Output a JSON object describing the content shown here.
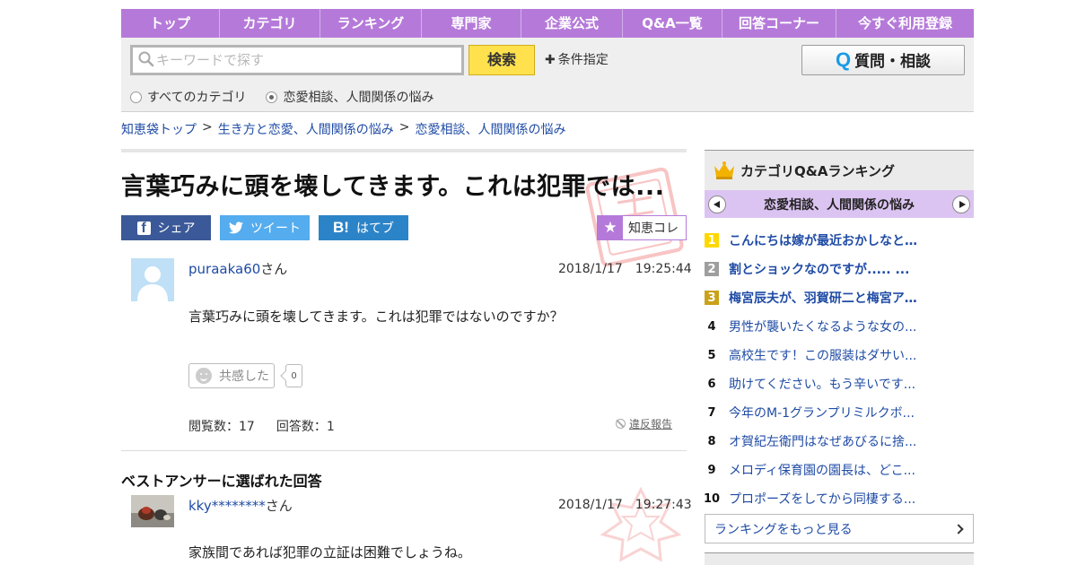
{
  "nav": [
    "トップ",
    "カテゴリ",
    "ランキング",
    "専門家",
    "企業公式",
    "Q&A一覧",
    "回答コーナー",
    "今すぐ利用登録"
  ],
  "search": {
    "placeholder": "キーワードで探す",
    "button": "検索",
    "condition": "条件指定",
    "ask_button": "質問・相談",
    "ask_icon": "Q",
    "radios": [
      "すべてのカテゴリ",
      "恋愛相談、人間関係の悩み"
    ],
    "radio_selected_index": 1
  },
  "breadcrumb": [
    {
      "label": "知恵袋トップ"
    },
    {
      "label": "生き方と恋愛、人間関係の悩み"
    },
    {
      "label": "恋愛相談、人間関係の悩み"
    }
  ],
  "breadcrumb_sep": ">",
  "question": {
    "title": "言葉巧みに頭を壊してきます。これは犯罪では...",
    "share": {
      "facebook": "シェア",
      "twitter": "ツイート",
      "hatena": "はてブ",
      "collect": "知恵コレ"
    },
    "user": "puraaka60",
    "user_suffix": "さん",
    "date": "2018/1/17　19:25:44",
    "body": "言葉巧みに頭を壊してきます。これは犯罪ではないのですか？",
    "empathy_label": "共感した",
    "empathy_count": "0",
    "views": "閲覧数：17",
    "answers": "回答数：1",
    "report": "違反報告"
  },
  "best_answer": {
    "heading": "ベストアンサーに選ばれた回答",
    "user": "kky********",
    "user_suffix": "さん",
    "date": "2018/1/17　19:27:43",
    "body": "家族間であれば犯罪の立証は困難でしょうね。"
  },
  "ranking": {
    "title": "カテゴリQ&Aランキング",
    "category": "恋愛相談、人間関係の悩み",
    "items": [
      {
        "rank": "1",
        "text": "こんにちは嫁が最近おかしなと..."
      },
      {
        "rank": "2",
        "text": "割とショックなのですが..... ..."
      },
      {
        "rank": "3",
        "text": "梅宮辰夫が、羽賀研二と梅宮ア..."
      },
      {
        "rank": "4",
        "text": "男性が襲いたくなるような女の..."
      },
      {
        "rank": "5",
        "text": "高校生です！この服装はダサい..."
      },
      {
        "rank": "6",
        "text": "助けてください。もう辛いです..."
      },
      {
        "rank": "7",
        "text": "今年のM-1グランプリミルクボ..."
      },
      {
        "rank": "8",
        "text": "オ賀紀左衛門はなぜあびるに捨..."
      },
      {
        "rank": "9",
        "text": "メロディ保育園の園長は、どこ..."
      },
      {
        "rank": "10",
        "text": "プロポーズをしてから同棲する..."
      }
    ],
    "more": "ランキングをもっと見る"
  },
  "colors": {
    "nav": "#b57ad9",
    "link": "#1f4ba5",
    "search_button": "#ffe14d",
    "facebook": "#3b5998",
    "twitter": "#55acee",
    "hatena": "#2c84c8",
    "ranking_category": "#dcc4f2"
  }
}
